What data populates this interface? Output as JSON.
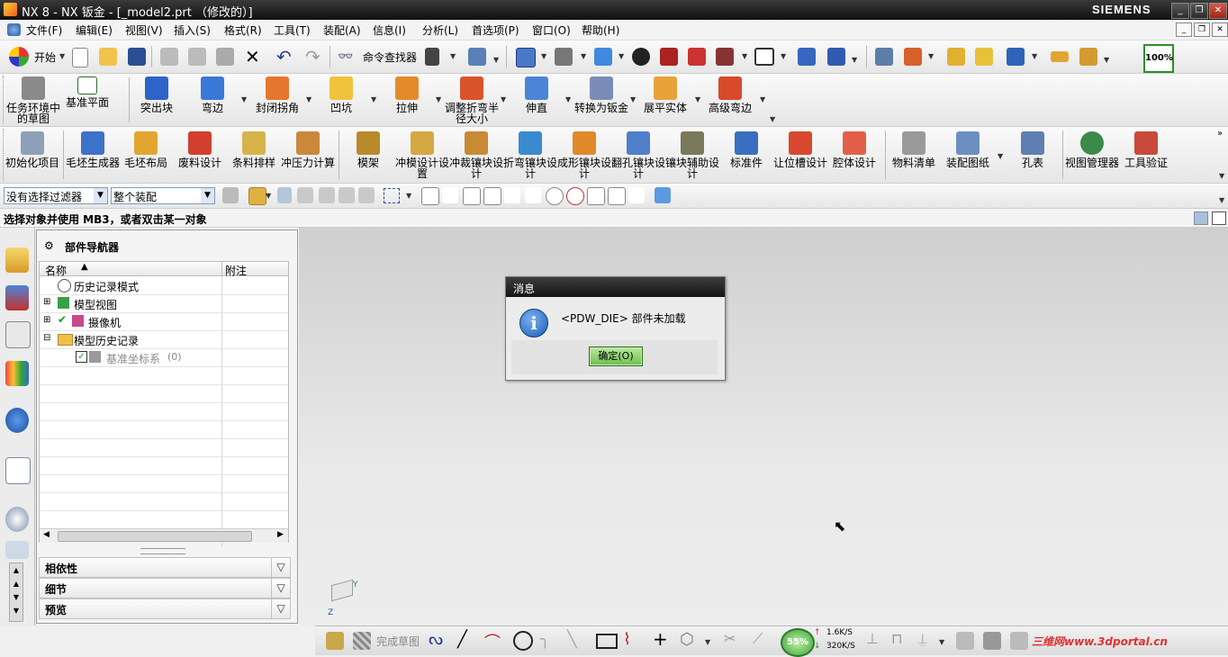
{
  "titlebar": {
    "title": "NX 8 - NX 钣金 - [_model2.prt （修改的）]",
    "brand": "SIEMENS",
    "min": "_",
    "max": "❐",
    "close": "✕"
  },
  "menu": {
    "items": [
      "文件(F)",
      "编辑(E)",
      "视图(V)",
      "插入(S)",
      "格式(R)",
      "工具(T)",
      "装配(A)",
      "信息(I)",
      "分析(L)",
      "首选项(P)",
      "窗口(O)",
      "帮助(H)"
    ]
  },
  "std_toolbar": {
    "start": "开始",
    "cmd_finder": "命令查找器",
    "zoom_label": "100%"
  },
  "sheetmetal_toolbar": {
    "items": [
      "任务环境中的草图",
      "基准平面",
      "突出块",
      "弯边",
      "封闭拐角",
      "凹坑",
      "拉伸",
      "调整折弯半径大小",
      "伸直",
      "转换为钣金",
      "展平实体",
      "高级弯边"
    ]
  },
  "die_toolbar": {
    "items": [
      "初始化项目",
      "毛坯生成器",
      "毛坯布局",
      "废料设计",
      "条料排样",
      "冲压力计算",
      "模架",
      "冲模设计设置",
      "冲裁镶块设计",
      "折弯镶块设计",
      "成形镶块设计",
      "翻孔镶块设计",
      "镶块辅助设计",
      "标准件",
      "让位槽设计",
      "腔体设计",
      "物料清单",
      "装配图纸",
      "孔表",
      "视图管理器",
      "工具验证"
    ]
  },
  "selection_bar": {
    "filter": "没有选择过滤器",
    "scope": "整个装配"
  },
  "status": {
    "prompt": "选择对象并使用 MB3，或者双击某一对象"
  },
  "navigator": {
    "title": "部件导航器",
    "columns": [
      "名称",
      "附注"
    ],
    "rows": [
      {
        "label": "历史记录模式",
        "icon": "clock-icon"
      },
      {
        "label": "模型视图",
        "icon": "model-views-icon"
      },
      {
        "label": "摄像机",
        "icon": "camera-icon"
      },
      {
        "label": "模型历史记录",
        "icon": "folder-icon"
      },
      {
        "label": "基准坐标系",
        "suffix": "(0)",
        "icon": "datum-csys-icon"
      }
    ],
    "panels": [
      "相依性",
      "细节",
      "预览"
    ]
  },
  "dialog": {
    "title": "消息",
    "message": "<PDW_DIE> 部件未加载",
    "ok": "确定(O)"
  },
  "bottom": {
    "finish_sketch": "完成草图",
    "cpu": "55%",
    "up_speed": "1.6K/S",
    "down_speed": "320K/S",
    "watermark": "三维网www.3dportal.cn"
  },
  "triad": {
    "y": "Y",
    "z": "Z"
  },
  "colors": {
    "accent_green": "#6bbf4c",
    "info_blue": "#1c5fb5",
    "titlebar": "#1c1c1c",
    "watermark_red": "#e03030"
  }
}
